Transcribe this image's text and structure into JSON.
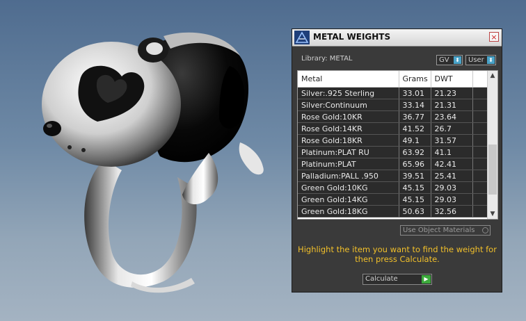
{
  "panel": {
    "title": "METAL WEIGHTS",
    "close_glyph": "×",
    "library_label": "Library: METAL",
    "gv_dropdown": "GV",
    "user_dropdown": "User",
    "table": {
      "headers": [
        "Metal",
        "Grams",
        "DWT"
      ],
      "rows": [
        [
          "Silver:.925 Sterling",
          "33.01",
          "21.23"
        ],
        [
          "Silver:Continuum",
          "33.14",
          "21.31"
        ],
        [
          "Rose Gold:10KR",
          "36.77",
          "23.64"
        ],
        [
          "Rose Gold:14KR",
          "41.52",
          "26.7"
        ],
        [
          "Rose Gold:18KR",
          "49.1",
          "31.57"
        ],
        [
          "Platinum:PLAT RU",
          "63.92",
          "41.1"
        ],
        [
          "Platinum:PLAT",
          "65.96",
          "42.41"
        ],
        [
          "Palladium:PALL .950",
          "39.51",
          "25.41"
        ],
        [
          "Green Gold:10KG",
          "45.15",
          "29.03"
        ],
        [
          "Green Gold:14KG",
          "45.15",
          "29.03"
        ],
        [
          "Green Gold:18KG",
          "50.63",
          "32.56"
        ]
      ]
    },
    "use_object_materials": "Use Object Materials",
    "instruction": "Highlight the item you want to find the weight for then press Calculate.",
    "calculate_label": "Calculate"
  },
  "colors": {
    "accent_yellow": "#f2c02a",
    "dropdown_arrow": "#4aa3c8",
    "calculate_arrow": "#3caa3c"
  },
  "icons": {
    "app_logo": "app-logo-icon",
    "close": "close-icon",
    "dropdown_arrow": "dropdown-arrow-icon",
    "go": "play-arrow-icon"
  }
}
